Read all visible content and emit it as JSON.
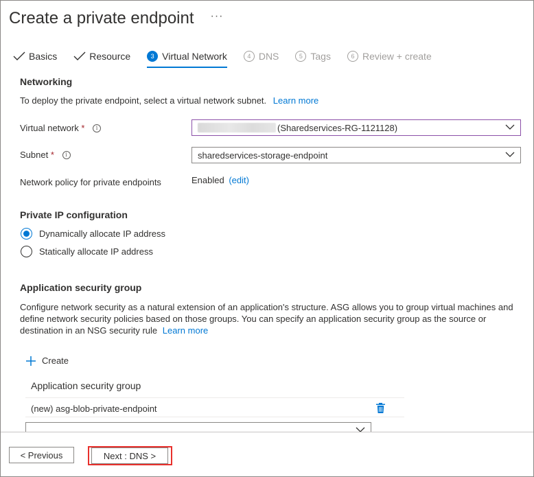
{
  "page": {
    "title": "Create a private endpoint",
    "more": "···"
  },
  "tabs": [
    {
      "label": "Basics",
      "state": "done"
    },
    {
      "label": "Resource",
      "state": "done"
    },
    {
      "num": "3",
      "label": "Virtual Network",
      "state": "active"
    },
    {
      "num": "4",
      "label": "DNS",
      "state": "disabled"
    },
    {
      "num": "5",
      "label": "Tags",
      "state": "disabled"
    },
    {
      "num": "6",
      "label": "Review + create",
      "state": "disabled"
    }
  ],
  "networking": {
    "title": "Networking",
    "description": "To deploy the private endpoint, select a virtual network subnet.",
    "learn_more": "Learn more",
    "vnet_label": "Virtual network",
    "vnet_value": "(Sharedservices-RG-1121128)",
    "subnet_label": "Subnet",
    "subnet_value": "sharedservices-storage-endpoint",
    "required_mark": "*",
    "info_icon_glyph": "i",
    "policy_label": "Network policy for private endpoints",
    "policy_value": "Enabled",
    "policy_edit": "(edit)"
  },
  "private_ip": {
    "title": "Private IP configuration",
    "options": [
      {
        "label": "Dynamically allocate IP address",
        "checked": true
      },
      {
        "label": "Statically allocate IP address",
        "checked": false
      }
    ]
  },
  "asg": {
    "title": "Application security group",
    "description_line1": "Configure network security as a natural extension of an application's structure. ASG allows you to group virtual machines and",
    "description_line2": "define network security policies based on those groups. You can specify an application security group as the source or",
    "description_line3": "destination in an NSG security rule",
    "learn_more": "Learn more",
    "create_label": "Create",
    "column_header": "Application security group",
    "rows": [
      "(new) asg-blob-private-endpoint"
    ],
    "new_select_value": ""
  },
  "footer": {
    "previous_label": "< Previous",
    "next_label": "Next : DNS >"
  },
  "colors": {
    "accent": "#0078d4",
    "required": "#a4262c",
    "highlight": "#e8302c",
    "focus_border": "#8b4fa8"
  }
}
